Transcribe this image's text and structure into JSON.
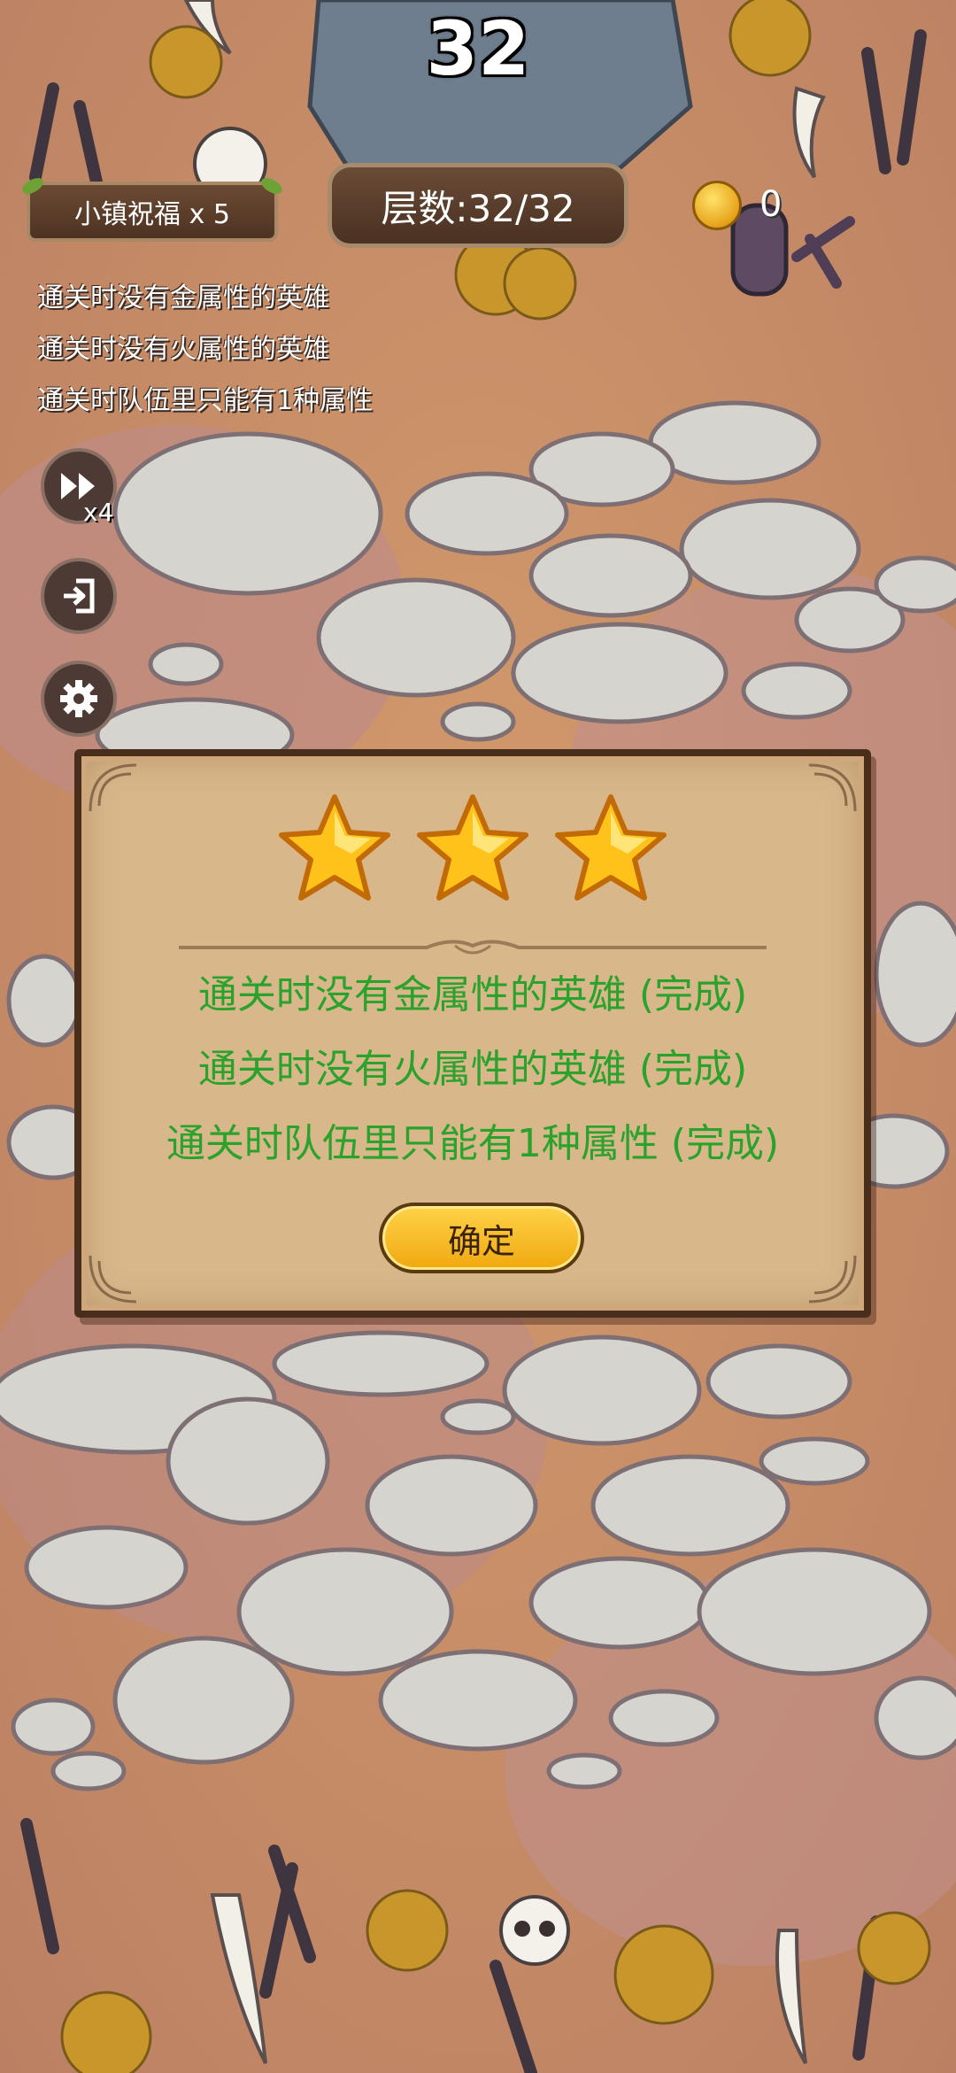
{
  "hud": {
    "stage_number": "32",
    "blessing": "小镇祝福 x 5",
    "floor": "层数:32/32",
    "coins": "0",
    "speed": "x4"
  },
  "quests": [
    "通关时没有金属性的英雄",
    "通关时没有火属性的英雄",
    "通关时队伍里只能有1种属性"
  ],
  "dialog": {
    "stars_earned": 3,
    "stars_total": 3,
    "results": [
      "通关时没有金属性的英雄 (完成)",
      "通关时没有火属性的英雄 (完成)",
      "通关时队伍里只能有1种属性 (完成)"
    ],
    "confirm_label": "确定"
  },
  "colors": {
    "result_text": "#2aa22c",
    "star": "#ffc21a",
    "button": "#f3b01a"
  },
  "icons": [
    "fast-forward-icon",
    "exit-icon",
    "gear-icon",
    "coin-icon",
    "star-icon"
  ]
}
